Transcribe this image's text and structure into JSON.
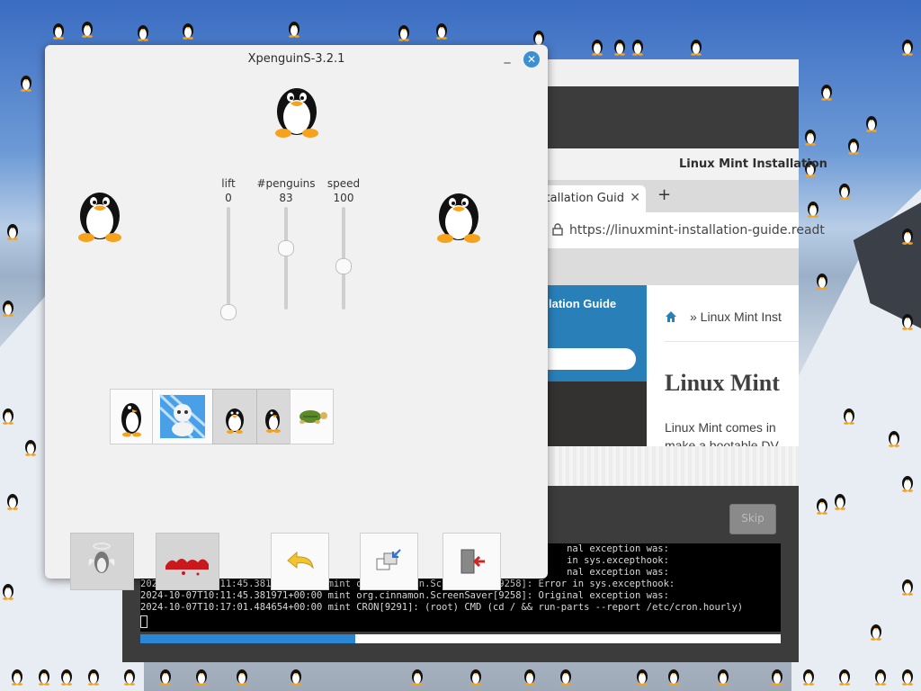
{
  "xpenguins": {
    "window_title": "XpenguinS-3.2.1",
    "sliders": [
      {
        "label": "lift",
        "value": "0",
        "fraction": 0.0
      },
      {
        "label": "#penguins",
        "value": "83",
        "fraction": 0.66
      },
      {
        "label": "speed",
        "value": "100",
        "fraction": 0.47
      }
    ],
    "themes": [
      {
        "name": "penguins-theme",
        "selected": false
      },
      {
        "name": "big-baby-theme",
        "selected": false
      },
      {
        "name": "classic-penguins-theme",
        "selected": true
      },
      {
        "name": "small-penguins-theme",
        "selected": true
      },
      {
        "name": "turtles-theme",
        "selected": false
      }
    ],
    "actions": [
      {
        "name": "angel-button",
        "enabled": false
      },
      {
        "name": "splat-button",
        "enabled": false
      },
      {
        "name": "undo-button",
        "enabled": true
      },
      {
        "name": "minimize-to-tray-button",
        "enabled": true
      },
      {
        "name": "quit-button",
        "enabled": true
      }
    ]
  },
  "browser": {
    "window_title": "Linux Mint Installation",
    "tab_label": "stallation Guid",
    "tab_close": "✕",
    "new_tab": "+",
    "url": "https://linuxmint-installation-guide.readt",
    "sidebar_title": "lation Guide",
    "breadcrumb": "» Linux Mint Inst",
    "heading": "Linux Mint",
    "body_line1": "Linux Mint comes in",
    "body_line2": "make a bootable DV"
  },
  "installer": {
    "skip_label": "Skip",
    "progress": 0.335,
    "terminal_lines": [
      "                                                                           nal exception was:",
      "                                                                           in sys.excepthook:",
      "                                                                           nal exception was:",
      "2024-10-07T10:11:45.381939+00:00 mint org.cinnamon.ScreenSaver[9258]: Error in sys.excepthook:",
      "2024-10-07T10:11:45.381971+00:00 mint org.cinnamon.ScreenSaver[9258]: Original exception was:",
      "2024-10-07T10:17:01.484654+00:00 mint CRON[9291]: (root) CMD (cd / && run-parts --report /etc/cron.hourly)"
    ]
  },
  "colors": {
    "accent": "#3a8fd5",
    "browser_sidebar": "#2980b9",
    "progress": "#2a87d6"
  }
}
